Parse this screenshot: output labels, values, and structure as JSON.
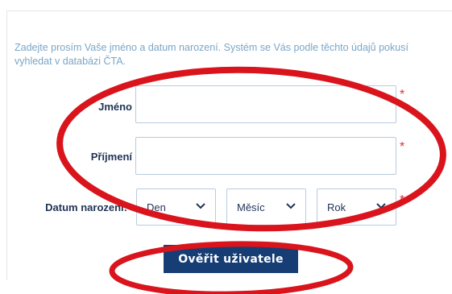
{
  "intro": {
    "text": "Zadejte prosím Vaše jméno a datum narození. Systém se Vás podle těchto údajů pokusí vyhledat v databázi ČTA."
  },
  "form": {
    "first_name": {
      "label": "Jméno",
      "value": "",
      "placeholder": ""
    },
    "last_name": {
      "label": "Příjmení",
      "value": "",
      "placeholder": ""
    },
    "birth_date": {
      "label": "Datum narození:",
      "day": "Den",
      "month": "Měsíc",
      "year": "Rok"
    },
    "required_mark": "*",
    "submit_label": "Ověřit uživatele"
  },
  "colors": {
    "accent": "#163e75",
    "intro_text": "#7aa6c8",
    "required": "#d9303a",
    "annotation": "#d9141c"
  },
  "icons": {
    "dropdown": "chevron-down-icon"
  }
}
